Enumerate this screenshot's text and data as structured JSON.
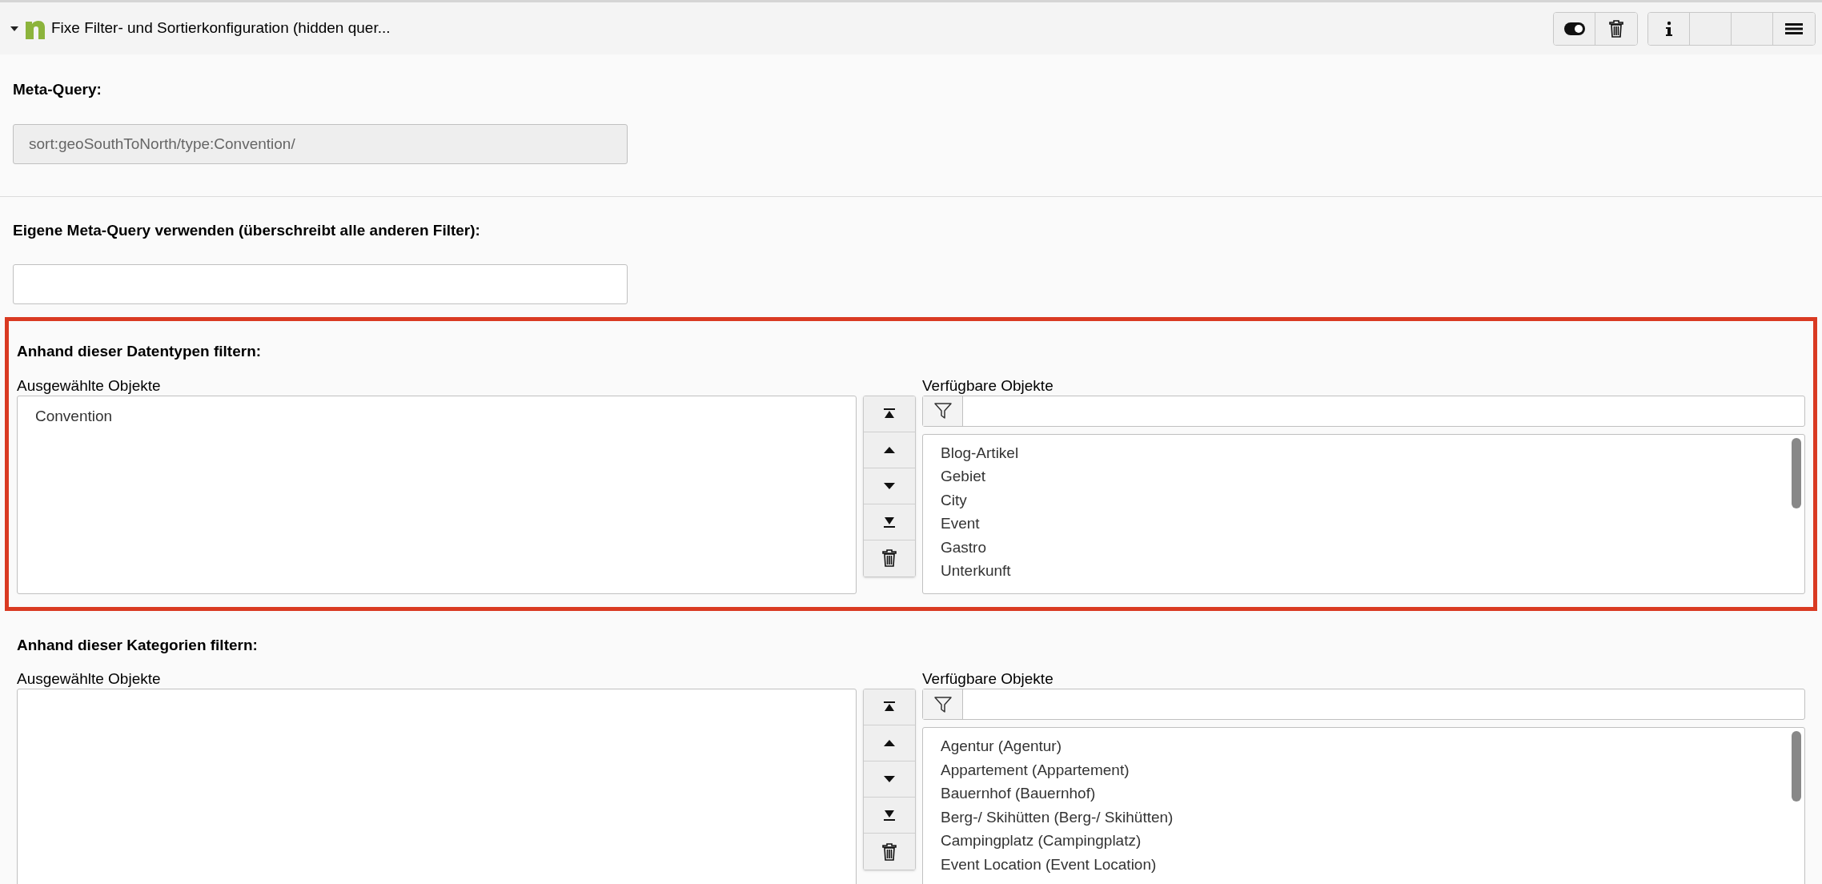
{
  "record": {
    "title": "Fixe Filter- und Sortierkonfiguration (hidden quer...",
    "expanded": true
  },
  "meta_query": {
    "label": "Meta-Query:",
    "value": "sort:geoSouthToNorth/type:Convention/",
    "disabled": true
  },
  "custom_query": {
    "label": "Eigene Meta-Query verwenden (überschreibt alle anderen Filter):"
  },
  "filters": [
    {
      "heading": "Anhand dieser Datentypen filtern:",
      "highlighted": true,
      "selected_label": "Ausgewählte Objekte",
      "selected_items": [
        "Convention"
      ],
      "available_label": "Verfügbare Objekte",
      "available_items": [
        "Blog-Artikel",
        "Gebiet",
        "City",
        "Event",
        "Gastro",
        "Unterkunft"
      ]
    },
    {
      "heading": "Anhand dieser Kategorien filtern:",
      "highlighted": false,
      "selected_label": "Ausgewählte Objekte",
      "available_label": "Verfügbare Objekte",
      "available_items": [
        "Agentur (Agentur)",
        "Appartement (Appartement)",
        "Bauernhof (Bauernhof)",
        "Berg-/ Skihütten (Berg-/ Skihütten)",
        "Campingplatz (Campingplatz)",
        "Event Location (Event Location)"
      ]
    }
  ]
}
